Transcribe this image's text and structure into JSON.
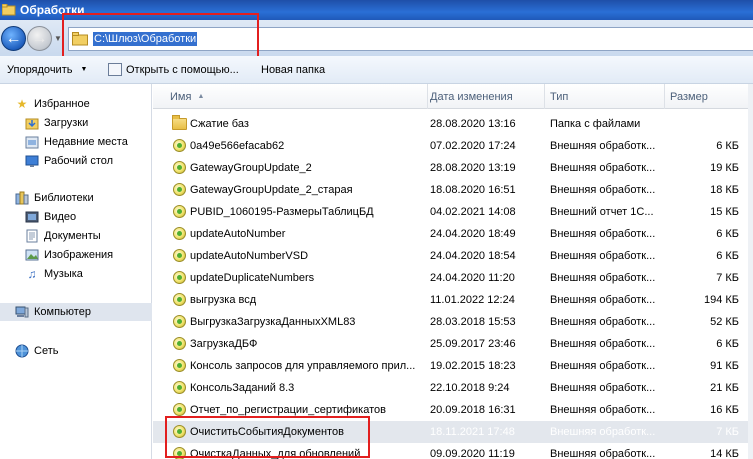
{
  "window": {
    "title": "Обработки"
  },
  "address": {
    "path": "C:\\Шлюз\\Обработки"
  },
  "toolbar": {
    "organize": "Упорядочить",
    "open_with": "Открыть с помощью...",
    "new_folder": "Новая папка"
  },
  "navpane": {
    "favorites": "Избранное",
    "downloads": "Загрузки",
    "recent": "Недавние места",
    "desktop": "Рабочий стол",
    "libraries": "Библиотеки",
    "video": "Видео",
    "documents": "Документы",
    "images": "Изображения",
    "music": "Музыка",
    "computer": "Компьютер",
    "network": "Сеть"
  },
  "columns": {
    "name": "Имя",
    "date": "Дата изменения",
    "type": "Тип",
    "size": "Размер"
  },
  "files": [
    {
      "name": "Сжатие баз",
      "date": "28.08.2020 13:16",
      "type": "Папка с файлами",
      "size": "",
      "kind": "folder"
    },
    {
      "name": "0a49e566efacab62",
      "date": "07.02.2020 17:24",
      "type": "Внешняя обработк...",
      "size": "6 КБ",
      "kind": "epf"
    },
    {
      "name": "GatewayGroupUpdate_2",
      "date": "28.08.2020 13:19",
      "type": "Внешняя обработк...",
      "size": "19 КБ",
      "kind": "epf"
    },
    {
      "name": "GatewayGroupUpdate_2_старая",
      "date": "18.08.2020 16:51",
      "type": "Внешняя обработк...",
      "size": "18 КБ",
      "kind": "epf"
    },
    {
      "name": "PUBID_1060195-РазмерыТаблицБД",
      "date": "04.02.2021 14:08",
      "type": "Внешний отчет 1С...",
      "size": "15 КБ",
      "kind": "erf"
    },
    {
      "name": "updateAutoNumber",
      "date": "24.04.2020 18:49",
      "type": "Внешняя обработк...",
      "size": "6 КБ",
      "kind": "epf"
    },
    {
      "name": "updateAutoNumberVSD",
      "date": "24.04.2020 18:54",
      "type": "Внешняя обработк...",
      "size": "6 КБ",
      "kind": "epf"
    },
    {
      "name": "updateDuplicateNumbers",
      "date": "24.04.2020 11:20",
      "type": "Внешняя обработк...",
      "size": "7 КБ",
      "kind": "epf"
    },
    {
      "name": "выгрузка всд",
      "date": "11.01.2022 12:24",
      "type": "Внешняя обработк...",
      "size": "194 КБ",
      "kind": "epf"
    },
    {
      "name": "ВыгрузкаЗагрузкаДанныхXML83",
      "date": "28.03.2018 15:53",
      "type": "Внешняя обработк...",
      "size": "52 КБ",
      "kind": "epf"
    },
    {
      "name": "ЗагрузкаДБФ",
      "date": "25.09.2017 23:46",
      "type": "Внешняя обработк...",
      "size": "6 КБ",
      "kind": "epf"
    },
    {
      "name": "Консоль запросов для управляемого прил...",
      "date": "19.02.2015 18:23",
      "type": "Внешняя обработк...",
      "size": "91 КБ",
      "kind": "epf"
    },
    {
      "name": "КонсольЗаданий 8.3",
      "date": "22.10.2018 9:24",
      "type": "Внешняя обработк...",
      "size": "21 КБ",
      "kind": "epf"
    },
    {
      "name": "Отчет_по_регистрации_сертификатов",
      "date": "20.09.2018 16:31",
      "type": "Внешняя обработк...",
      "size": "16 КБ",
      "kind": "epf"
    },
    {
      "name": "ОчиститьСобытияДокументов",
      "date": "18.11.2021 17:48",
      "type": "Внешняя обработк...",
      "size": "7 КБ",
      "kind": "epf",
      "selected": true
    },
    {
      "name": "ОчисткаДанных_для обновлений",
      "date": "09.09.2020 11:19",
      "type": "Внешняя обработк...",
      "size": "14 КБ",
      "kind": "epf"
    }
  ]
}
